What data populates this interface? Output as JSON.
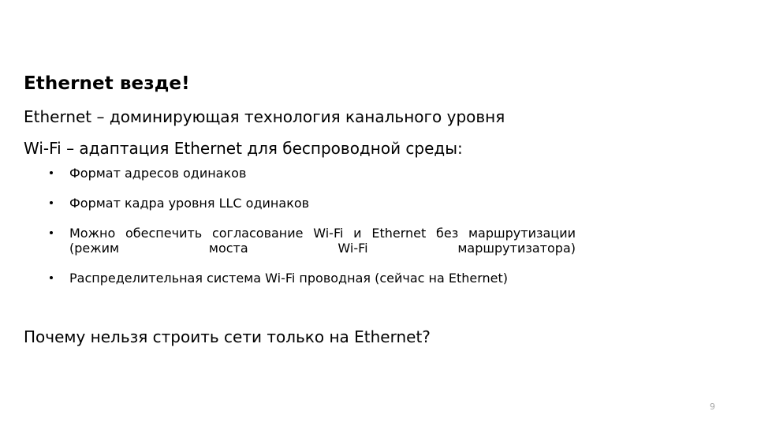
{
  "slide": {
    "title": "Ethernet везде!",
    "paragraphs": [
      "Ethernet – доминирующая технология канального уровня",
      "Wi-Fi – адаптация Ethernet для беспроводной среды:"
    ],
    "bullets": [
      "Формат адресов одинаков",
      "Формат кадра уровня LLC одинаков",
      "Можно обеспечить согласование Wi-Fi и Ethernet без маршрутизации (режим моста Wi-Fi маршрутизатора)",
      "Распределительная система Wi-Fi проводная (сейчас на Ethernet)"
    ],
    "closing_question": "Почему нельзя строить сети только на Ethernet?",
    "page_number": "9",
    "colors": {
      "background": "#ffffff",
      "text": "#000000",
      "page_number": "#a6a6a6"
    }
  }
}
